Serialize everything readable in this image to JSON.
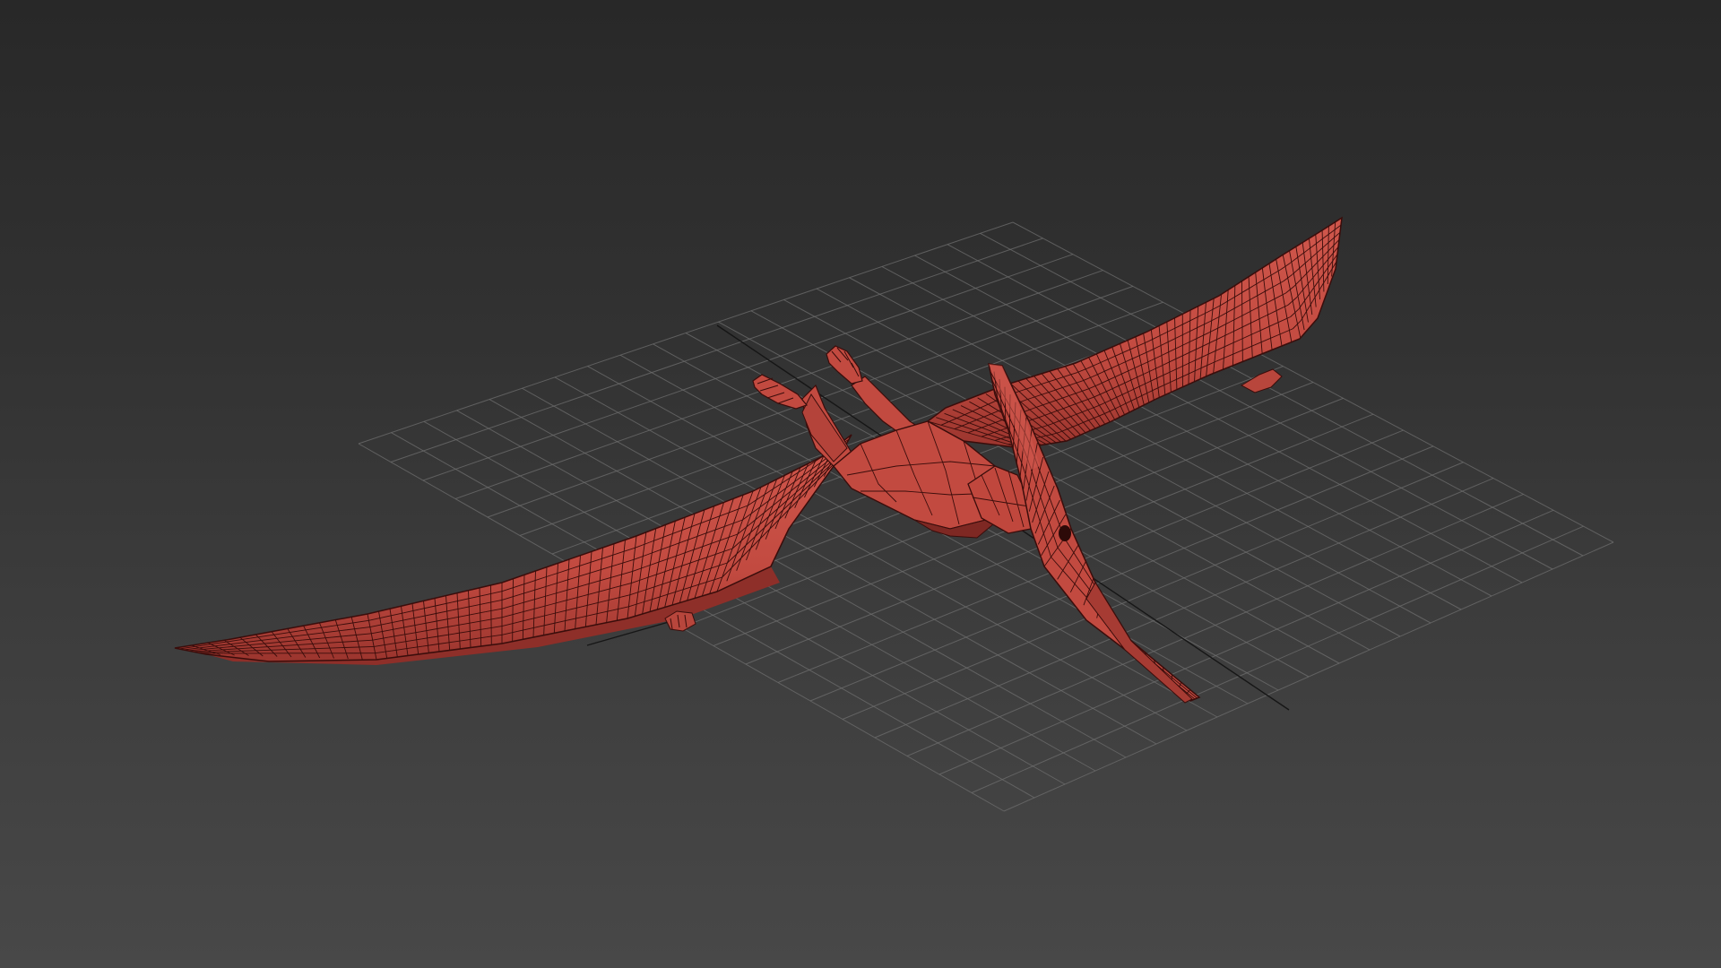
{
  "viewport": {
    "background_top": "#282828",
    "background_bottom": "#484848",
    "grid_color": "#6e6e6e",
    "axis_color": "#141414",
    "model_fill": "#c24a40",
    "model_shadow": "#8e2f29",
    "model_highlight": "#d8665b",
    "wire_color": "#3a0d0b",
    "model_subject": "pteranodon"
  }
}
